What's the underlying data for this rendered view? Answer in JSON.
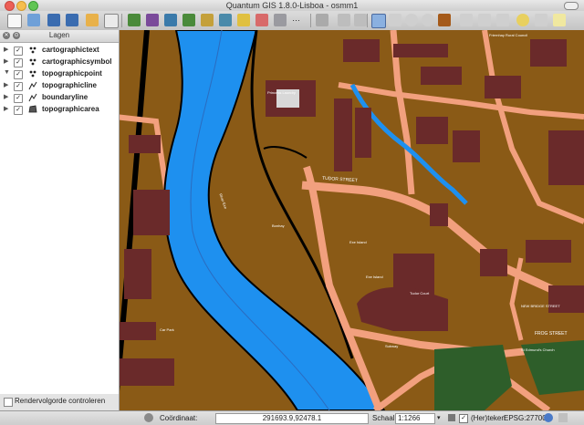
{
  "window": {
    "title": "Quantum GIS 1.8.0-Lisboa - osmm1"
  },
  "toolbar": {
    "zoom_label": "…"
  },
  "legend": {
    "title": "Lagen",
    "layers": [
      {
        "name": "cartographictext",
        "expanded": false,
        "checked": true,
        "icon": "point-layer-icon"
      },
      {
        "name": "cartographicsymbol",
        "expanded": false,
        "checked": true,
        "icon": "point-layer-icon"
      },
      {
        "name": "topographicpoint",
        "expanded": true,
        "checked": true,
        "icon": "point-layer-icon"
      },
      {
        "name": "topographicline",
        "expanded": false,
        "checked": true,
        "icon": "line-layer-icon"
      },
      {
        "name": "boundaryline",
        "expanded": false,
        "checked": true,
        "icon": "line-layer-icon"
      },
      {
        "name": "topographicarea",
        "expanded": false,
        "checked": true,
        "icon": "polygon-layer-icon"
      }
    ]
  },
  "render_order": {
    "label": "Rendervolgorde controleren",
    "checked": false
  },
  "status": {
    "coord_label": "Coördinaat:",
    "coord_value": "291693.9,92478.1",
    "scale_label": "Schaal",
    "scale_value": "1:1266",
    "render_label": "(Her)teken",
    "render_checked": true,
    "crs": "EPSG:27700"
  },
  "map": {
    "labels": [
      {
        "text": "TUDOR STREET"
      },
      {
        "text": "FROG STREET"
      },
      {
        "text": "Princess Laundry"
      },
      {
        "text": "River Exe"
      },
      {
        "text": "Exe Island"
      },
      {
        "text": "Car Park"
      },
      {
        "text": "Bonhay"
      },
      {
        "text": "Tudor Court"
      },
      {
        "text": "Subway"
      },
      {
        "text": "Friernhay Rural Council"
      },
      {
        "text": "Exe Island"
      },
      {
        "text": "St Edmund's Church"
      },
      {
        "text": "NEW BRIDGE STREET"
      }
    ],
    "colors": {
      "land": "#8a5a16",
      "water": "#1e90ef",
      "road": "#f2a07e",
      "building": "#6a2a2a",
      "park": "#2e5e2a",
      "track": "#000000"
    }
  }
}
